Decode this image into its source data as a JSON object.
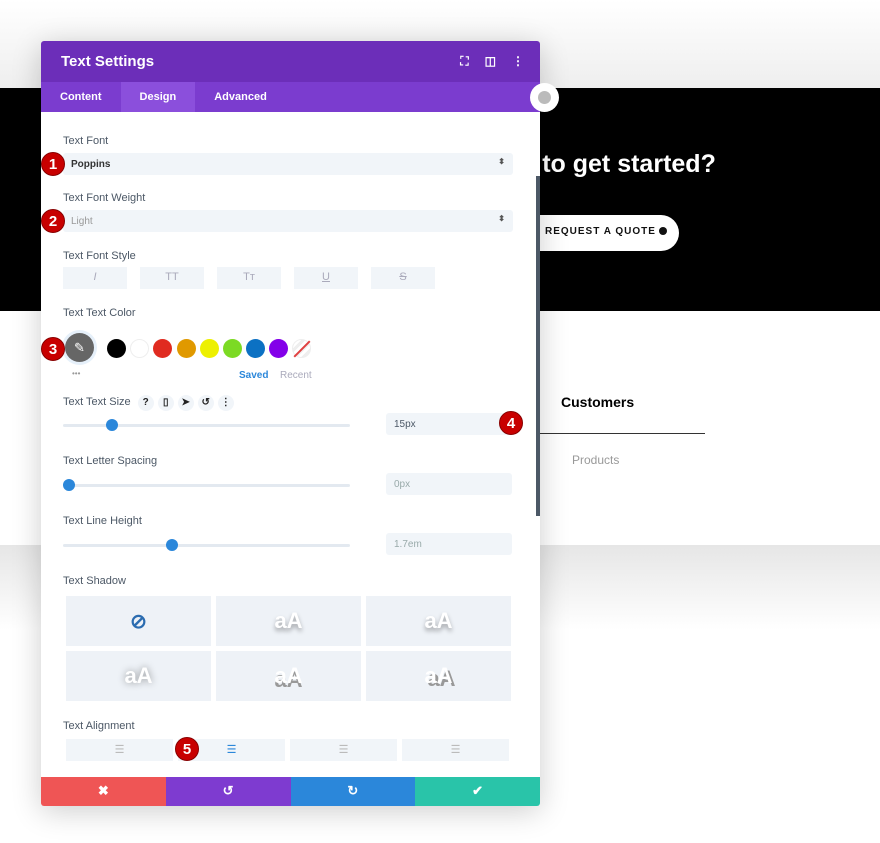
{
  "background": {
    "headline": "d to get started?",
    "quote_button": "REQUEST A QUOTE",
    "tab_customers": "Customers",
    "tab_products": "Products"
  },
  "panel": {
    "title": "Text Settings",
    "tabs": [
      "Content",
      "Design",
      "Advanced"
    ],
    "active_tab": "Design",
    "font": {
      "label": "Text Font",
      "value": "Poppins"
    },
    "weight": {
      "label": "Text Font Weight",
      "value": "Light"
    },
    "style": {
      "label": "Text Font Style",
      "buttons": [
        "I",
        "TT",
        "Tт",
        "U",
        "S"
      ]
    },
    "color": {
      "label": "Text Text Color",
      "swatches": [
        "#000000",
        "#ffffff",
        "#e02b20",
        "#e09900",
        "#edf000",
        "#7cda24",
        "#0c71c3",
        "#8300e9"
      ],
      "saved": "Saved",
      "recent": "Recent",
      "more": "•••"
    },
    "size": {
      "label": "Text Text Size",
      "value": "15px",
      "percent": 15,
      "mini_icons": [
        "?",
        "▯",
        "➤",
        "↺",
        "⋮"
      ]
    },
    "spacing": {
      "label": "Text Letter Spacing",
      "value": "0px",
      "percent": 0
    },
    "line_height": {
      "label": "Text Line Height",
      "value": "1.7em",
      "percent": 36
    },
    "shadow": {
      "label": "Text Shadow",
      "preview": "aA",
      "none": "⊘"
    },
    "alignment": {
      "label": "Text Alignment",
      "selected": "center"
    },
    "footer": {
      "cancel": "✖",
      "undo": "↺",
      "redo": "↻",
      "save": "✔"
    }
  },
  "badges": [
    "1",
    "2",
    "3",
    "4",
    "5"
  ],
  "colors": {
    "header": "#6c2eb9",
    "tabs": "#7b3ccf",
    "cancel": "#ef5555",
    "undo": "#7e3bd0",
    "redo": "#2b87da",
    "save": "#29c4a9"
  }
}
